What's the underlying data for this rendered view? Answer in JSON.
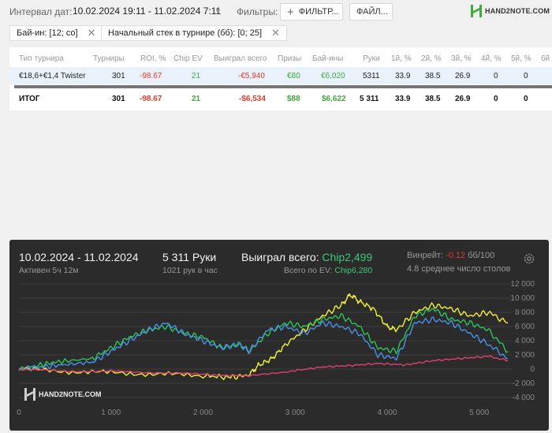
{
  "topbar": {
    "interval_label": "Интервал дат:",
    "interval_value": "10.02.2024 19:11 - 11.02.2024 7:11",
    "filters_label": "Фильтры:",
    "filter_button": "ФИЛЬТР...",
    "file_button": "ФАЙЛ...",
    "logo_text": "HAND2NOTE.COM"
  },
  "chips": [
    {
      "label": "Бай-ин: [12; co]"
    },
    {
      "label": "Начальный стек в турнире (бб): [0; 25]"
    }
  ],
  "table": {
    "columns": [
      "Тип турнира",
      "Турниры",
      "ROI, %",
      "Chip EV",
      "Выиграл всего",
      "Призы",
      "Бай-ины",
      "Руки",
      "1й, %",
      "2й, %",
      "3й, %",
      "4й, %",
      "5й, %",
      "6й"
    ],
    "rows": [
      {
        "type": "€18,6+€1,4 Twister",
        "tournaments": "301",
        "roi": "-98.67",
        "chip_ev": "21",
        "won": "-€5,940",
        "prizes": "€80",
        "buyins": "€6,020",
        "hands": "5311",
        "p1": "33.9",
        "p2": "38.5",
        "p3": "26.9",
        "p4": "0",
        "p5": "0"
      }
    ],
    "total": {
      "type": "ИТОГ",
      "tournaments": "301",
      "roi": "-98.67",
      "chip_ev": "21",
      "won": "-$6,534",
      "prizes": "$88",
      "buyins": "$6,622",
      "hands": "5 311",
      "p1": "33.9",
      "p2": "38.5",
      "p3": "26.9",
      "p4": "0",
      "p5": "0"
    }
  },
  "chart_panel": {
    "date_range": "10.02.2024 - 11.02.2024",
    "active": "Активен 5ч 12м",
    "hands": "5 311 Руки",
    "hands_per_hour": "1021 рук в час",
    "won_label": "Выиграл всего:",
    "won_value": "Chip2,499",
    "ev_label": "Всего по EV:",
    "ev_value": "Chip6,280",
    "winrate_label": "Винрейт:",
    "winrate_value": "-0.12",
    "winrate_unit": "бб/100",
    "avg_tables": "4.8 среднее число столов",
    "logo_text": "HAND2NOTE.COM"
  },
  "colors": {
    "accent_green": "#43a83e",
    "accent_red": "#e03a2a",
    "series_yellow": "#f2f03a",
    "series_green": "#2ec45a",
    "series_blue": "#4a90e6",
    "series_pink": "#e0406e"
  },
  "chart_data": {
    "type": "line",
    "x_ticks": [
      "0",
      "1 000",
      "2 000",
      "3 000",
      "4 000",
      "5 000"
    ],
    "y_ticks": [
      "12 000",
      "10 000",
      "8 000",
      "6 000",
      "4 000",
      "2 000",
      "0",
      "-2 000",
      "-4 000"
    ],
    "xlim": [
      0,
      5311
    ],
    "ylim": [
      -4000,
      12000
    ],
    "grid": true,
    "series": [
      {
        "color": "#f2f03a",
        "x": [
          0,
          500,
          1000,
          1500,
          2000,
          2300,
          2500,
          2600,
          2750,
          2900,
          3100,
          3300,
          3500,
          3600,
          3700,
          3850,
          4000,
          4100,
          4300,
          4500,
          4700,
          4900,
          5100,
          5311
        ],
        "y": [
          0,
          -300,
          -500,
          -700,
          -900,
          -1200,
          -800,
          500,
          1500,
          3500,
          5500,
          7500,
          9000,
          10500,
          9500,
          8500,
          6000,
          5500,
          8000,
          9000,
          8500,
          7500,
          8000,
          6500
        ]
      },
      {
        "color": "#2ec45a",
        "x": [
          0,
          400,
          800,
          1000,
          1200,
          1400,
          1600,
          1800,
          2000,
          2200,
          2400,
          2500,
          2700,
          2900,
          3100,
          3300,
          3500,
          3700,
          3900,
          4100,
          4300,
          4500,
          4700,
          4900,
          5100,
          5311
        ],
        "y": [
          0,
          1000,
          1500,
          3000,
          4500,
          5500,
          6000,
          5000,
          4500,
          3000,
          3500,
          2500,
          5000,
          6500,
          6000,
          7000,
          7500,
          6000,
          3000,
          2500,
          7500,
          8500,
          7000,
          6500,
          5500,
          2500
        ]
      },
      {
        "color": "#4a90e6",
        "x": [
          0,
          400,
          800,
          1000,
          1200,
          1400,
          1600,
          1800,
          2000,
          2200,
          2400,
          2500,
          2700,
          2900,
          3100,
          3300,
          3500,
          3700,
          3900,
          4100,
          4300,
          4500,
          4700,
          4900,
          5100,
          5311
        ],
        "y": [
          0,
          500,
          1000,
          2500,
          4000,
          5500,
          6500,
          5000,
          4000,
          3000,
          3500,
          2500,
          5500,
          6000,
          5000,
          6500,
          6000,
          5000,
          2000,
          1500,
          6500,
          7000,
          6500,
          5000,
          3500,
          1500
        ]
      },
      {
        "color": "#e0406e",
        "x": [
          0,
          500,
          1000,
          1500,
          2000,
          2500,
          3000,
          3300,
          3600,
          3900,
          4200,
          4500,
          4800,
          5100,
          5311
        ],
        "y": [
          0,
          -300,
          -300,
          -500,
          -700,
          -1000,
          -200,
          300,
          500,
          800,
          600,
          1200,
          1500,
          1800,
          1200
        ]
      }
    ]
  }
}
